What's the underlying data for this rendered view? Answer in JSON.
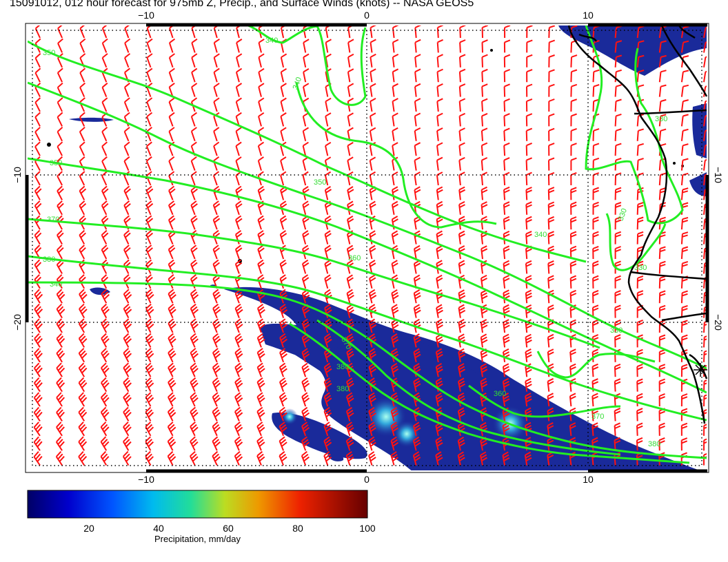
{
  "title": "15091012, 012 hour forecast for 975mb Z, Precip., and Surface Winds (knots) -- NASA GEOS5",
  "axes": {
    "top_labels": [
      "−10",
      "0",
      "10"
    ],
    "bottom_labels": [
      "−10",
      "0",
      "10"
    ],
    "left_labels": [
      "−10",
      "−20"
    ],
    "right_labels": [
      "−10",
      "−20"
    ]
  },
  "contours": {
    "color": "#22ee22",
    "levels": [
      "340",
      "350",
      "360",
      "370",
      "380"
    ],
    "labels": [
      "350",
      "340",
      "340",
      "360",
      "350",
      "370",
      "380",
      "340",
      "360",
      "340",
      "330",
      "330",
      "330",
      "370",
      "380",
      "360",
      "370",
      "380",
      "330",
      "380"
    ]
  },
  "colorbar": {
    "label": "Precipitation, mm/day",
    "ticks": [
      "20",
      "40",
      "60",
      "80",
      "100"
    ],
    "colors": [
      "#000066",
      "#0000cc",
      "#0066ff",
      "#00ccdd",
      "#66dd66",
      "#dddd00",
      "#ee7700",
      "#dd0000",
      "#660000"
    ]
  },
  "colors": {
    "barbs": "#ff1111",
    "land": "#000000",
    "precip_low": "#1a2a9a"
  },
  "markers": {
    "station": "asterisk"
  }
}
